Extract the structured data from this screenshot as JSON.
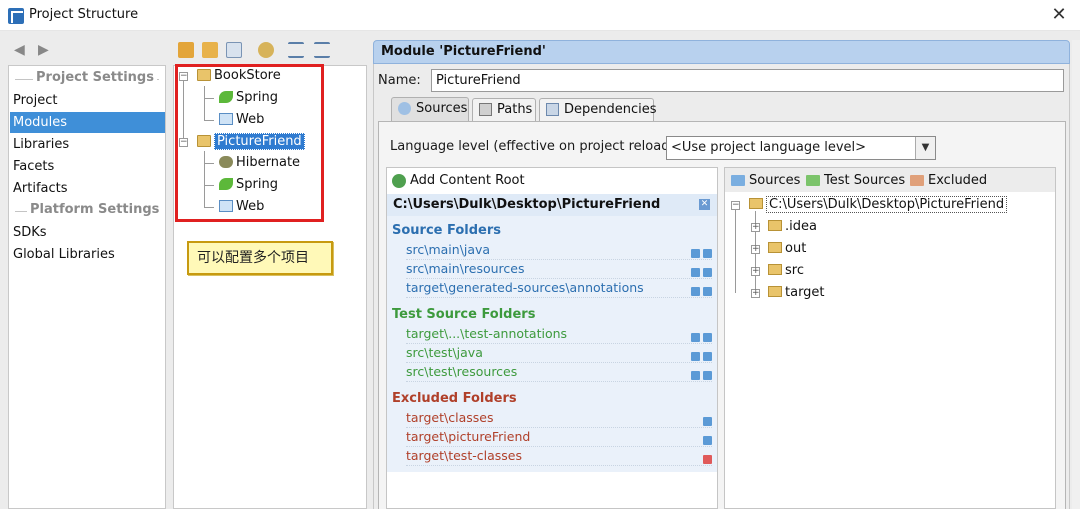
{
  "window": {
    "title": "Project Structure",
    "close_glyph": "✕"
  },
  "nav": {
    "project_settings_header": "Project Settings",
    "platform_settings_header": "Platform Settings",
    "project_items": [
      "Project",
      "Modules",
      "Libraries",
      "Facets",
      "Artifacts"
    ],
    "platform_items": [
      "SDKs",
      "Global Libraries"
    ],
    "selected": "Modules"
  },
  "tree": {
    "modules": [
      {
        "name": "BookStore",
        "facets": [
          "Spring",
          "Web"
        ]
      },
      {
        "name": "PictureFriend",
        "facets": [
          "Hibernate",
          "Spring",
          "Web"
        ]
      }
    ],
    "selected": "PictureFriend"
  },
  "annotation": {
    "text": "可以配置多个项目"
  },
  "module": {
    "header": "Module 'PictureFriend'",
    "name_label": "Name:",
    "name_value": "PictureFriend",
    "tabs": [
      "Sources",
      "Paths",
      "Dependencies"
    ],
    "active_tab": "Sources",
    "language_label": "Language level (effective on project reload):",
    "language_value": "<Use project language level>"
  },
  "content_roots": {
    "add_label": "Add Content Root",
    "root_path": "C:\\Users\\Dulk\\Desktop\\PictureFriend",
    "source_title": "Source Folders",
    "source_folders": [
      "src\\main\\java",
      "src\\main\\resources",
      "target\\generated-sources\\annotations"
    ],
    "test_title": "Test Source Folders",
    "test_folders": [
      "target\\...\\test-annotations",
      "src\\test\\java",
      "src\\test\\resources"
    ],
    "excluded_title": "Excluded Folders",
    "excluded_folders": [
      "target\\classes",
      "target\\pictureFriend",
      "target\\test-classes"
    ]
  },
  "file_tree": {
    "markers": [
      "Sources",
      "Test Sources",
      "Excluded"
    ],
    "root": "C:\\Users\\Dulk\\Desktop\\PictureFriend",
    "children": [
      ".idea",
      "out",
      "src",
      "target"
    ]
  },
  "colors": {
    "source": "#2c6fb0",
    "test": "#3d9a3d",
    "excluded": "#b0402a",
    "selection": "#3f8fd8",
    "highlight_box": "#e02020"
  }
}
